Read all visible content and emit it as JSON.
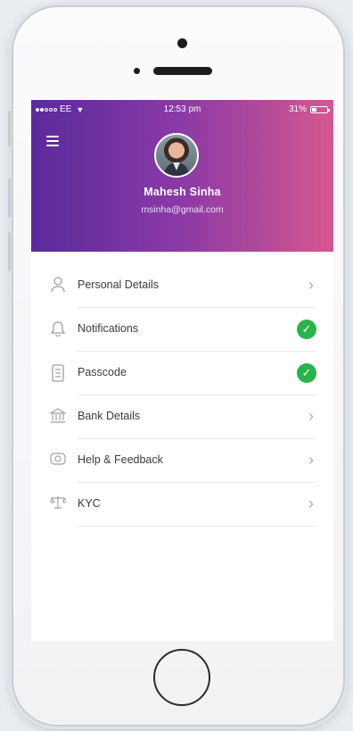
{
  "status_bar": {
    "carrier": "EE",
    "time": "12:53 pm",
    "battery_percent": "31%",
    "battery_level": 0.31,
    "signal_bars_filled": 2,
    "signal_bars_total": 5
  },
  "profile": {
    "name": "Mahesh Sinha",
    "email": "msinha@gmail.com"
  },
  "menu": {
    "items": [
      {
        "label": "Personal Details",
        "icon": "user-icon",
        "trailing": "chevron-right-icon"
      },
      {
        "label": "Notifications",
        "icon": "bell-icon",
        "trailing": "check-icon"
      },
      {
        "label": "Passcode",
        "icon": "lock-icon",
        "trailing": "check-icon"
      },
      {
        "label": "Bank Details",
        "icon": "bank-icon",
        "trailing": "chevron-right-icon"
      },
      {
        "label": "Help & Feedback",
        "icon": "help-icon",
        "trailing": "chevron-right-icon"
      },
      {
        "label": "KYC",
        "icon": "id-card-icon",
        "trailing": "chevron-right-icon"
      }
    ]
  },
  "colors": {
    "header_gradient_start": "#5a2a9c",
    "header_gradient_end": "#d5578f",
    "check_green": "#28b44b"
  }
}
